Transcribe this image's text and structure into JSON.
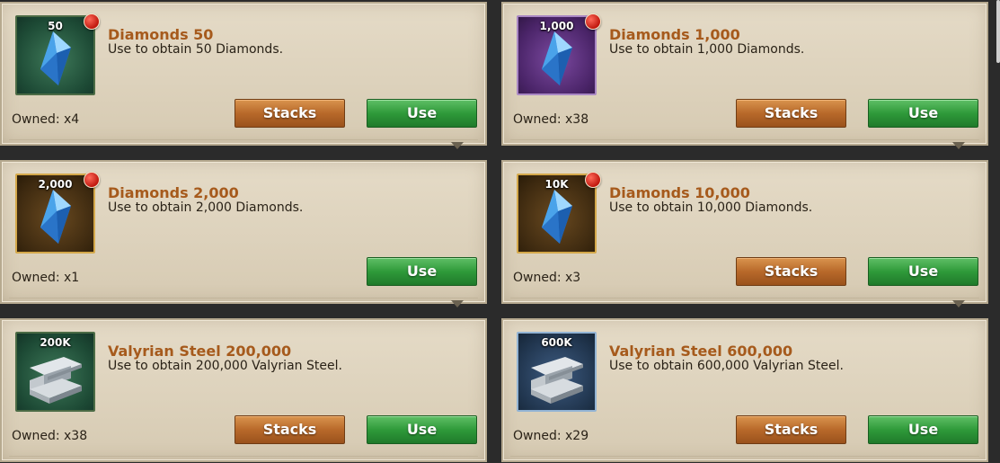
{
  "items": [
    {
      "badge": "50",
      "title": "Diamonds 50",
      "description": "Use to obtain 50 Diamonds.",
      "owned": "Owned: x4",
      "stacks_label": "Stacks",
      "use_label": "Use",
      "frame": "green",
      "icon": "diamond-icon",
      "has_stacks": true,
      "has_dot": true
    },
    {
      "badge": "1,000",
      "title": "Diamonds 1,000",
      "description": "Use to obtain 1,000 Diamonds.",
      "owned": "Owned: x38",
      "stacks_label": "Stacks",
      "use_label": "Use",
      "frame": "purple",
      "icon": "diamond-icon",
      "has_stacks": true,
      "has_dot": true
    },
    {
      "badge": "2,000",
      "title": "Diamonds 2,000",
      "description": "Use to obtain 2,000 Diamonds.",
      "owned": "Owned: x1",
      "stacks_label": "",
      "use_label": "Use",
      "frame": "gold",
      "icon": "diamond-icon",
      "has_stacks": false,
      "has_dot": true
    },
    {
      "badge": "10K",
      "title": "Diamonds 10,000",
      "description": "Use to obtain 10,000 Diamonds.",
      "owned": "Owned: x3",
      "stacks_label": "Stacks",
      "use_label": "Use",
      "frame": "gold",
      "icon": "diamond-icon",
      "has_stacks": true,
      "has_dot": true
    },
    {
      "badge": "200K",
      "title": "Valyrian Steel 200,000",
      "description": "Use to obtain 200,000 Valyrian Steel.",
      "owned": "Owned: x38",
      "stacks_label": "Stacks",
      "use_label": "Use",
      "frame": "green",
      "icon": "steel-ingot-icon",
      "has_stacks": true,
      "has_dot": false
    },
    {
      "badge": "600K",
      "title": "Valyrian Steel 600,000",
      "description": "Use to obtain 600,000 Valyrian Steel.",
      "owned": "Owned: x29",
      "stacks_label": "Stacks",
      "use_label": "Use",
      "frame": "blue",
      "icon": "steel-ingot-icon",
      "has_stacks": true,
      "has_dot": false
    }
  ],
  "colors": {
    "title": "#a65a1c",
    "use_button": "#2f9a3a",
    "stacks_button": "#b8692a",
    "notification_dot": "#c0180e"
  }
}
